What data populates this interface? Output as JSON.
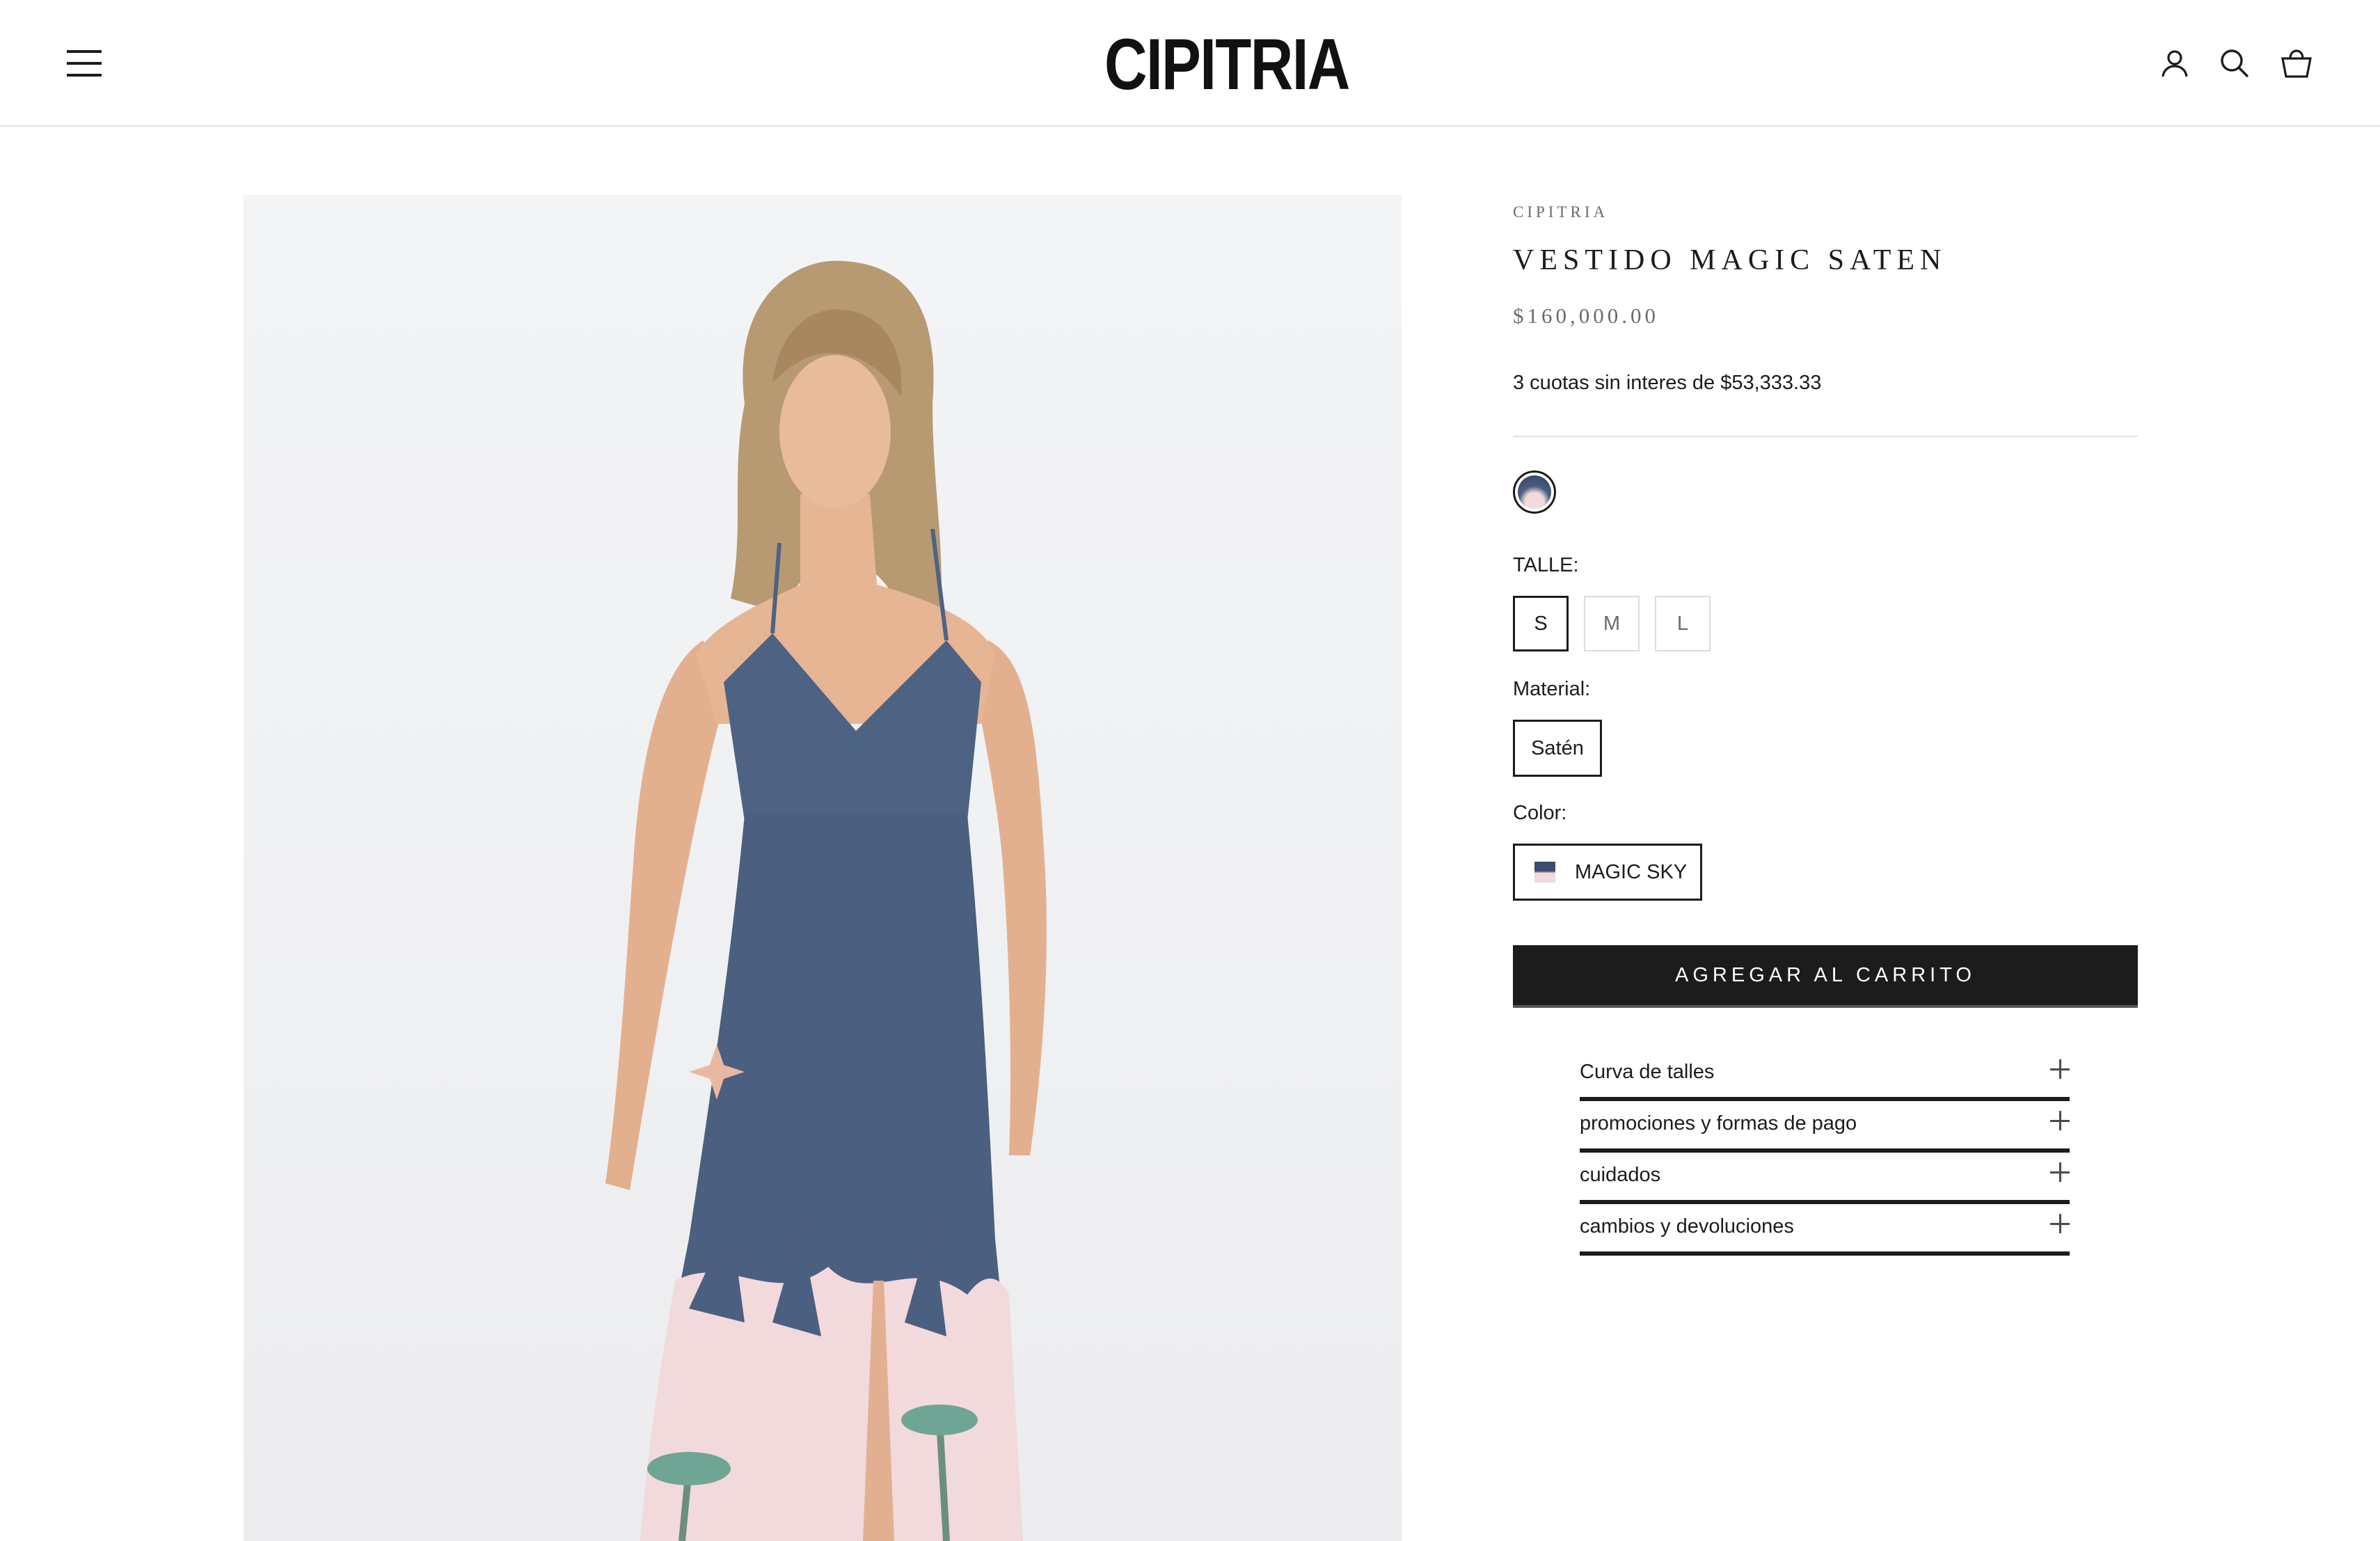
{
  "header": {
    "logo": "CIPITRIA",
    "icons": [
      "menu-icon",
      "account-icon",
      "search-icon",
      "cart-icon"
    ]
  },
  "product": {
    "vendor": "CIPITRIA",
    "title": "VESTIDO MAGIC SATEN",
    "price": "$160,000.00",
    "installments": "3 cuotas sin interes de $53,333.33",
    "size_label": "TALLE:",
    "sizes": [
      "S",
      "M",
      "L"
    ],
    "selected_size": "S",
    "material_label": "Material:",
    "material": "Satén",
    "color_label": "Color:",
    "color": "MAGIC SKY",
    "add_to_cart": "AGREGAR AL CARRITO"
  },
  "accordion": [
    {
      "label": "Curva de talles"
    },
    {
      "label": "promociones y formas de pago"
    },
    {
      "label": "cuidados"
    },
    {
      "label": "cambios y devoluciones"
    }
  ],
  "colors": {
    "accent": "#1c1c1c",
    "dress_blue": "#4b5f80",
    "dress_pink": "#f2d9dc"
  }
}
